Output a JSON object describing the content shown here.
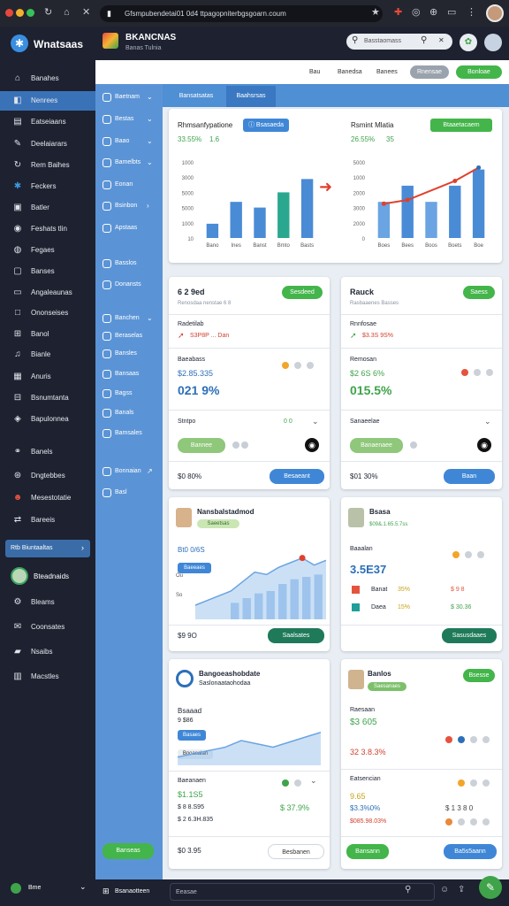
{
  "browser": {
    "url": "Gfsmpubendetai01 0d4 ttpagopniterbgsgoarn.coum",
    "traffic_colors": [
      "#e8473c",
      "#f2b22b",
      "#37c15a"
    ]
  },
  "sidebar": {
    "logo_text": "Wnatsaas",
    "items": [
      {
        "label": "Banahes",
        "icon": "home-icon"
      },
      {
        "label": "Nenrees",
        "icon": "layers-icon"
      },
      {
        "label": "Eatseiaans",
        "icon": "document-icon"
      },
      {
        "label": "Deelaiarars",
        "icon": "pen-icon"
      },
      {
        "label": "Rem Baihes",
        "icon": "refresh-icon"
      },
      {
        "label": "Feckers",
        "icon": "star-icon"
      },
      {
        "label": "Batler",
        "icon": "box-icon"
      },
      {
        "label": "Feshats tlin",
        "icon": "camera-icon"
      },
      {
        "label": "Fegaes",
        "icon": "globe-icon"
      },
      {
        "label": "Banses",
        "icon": "chat-icon"
      },
      {
        "label": "Angaleaunas",
        "icon": "screen-icon"
      },
      {
        "label": "Ononseises",
        "icon": "square-icon"
      },
      {
        "label": "Banol",
        "icon": "grid-icon"
      },
      {
        "label": "Bianle",
        "icon": "music-icon"
      },
      {
        "label": "Anuris",
        "icon": "calendar-icon"
      },
      {
        "label": "Bsnumtanta",
        "icon": "tiles-icon"
      },
      {
        "label": "Bapulonnea",
        "icon": "cube-icon"
      },
      {
        "label": "Banels",
        "icon": "link-icon"
      },
      {
        "label": "Dngtebbes",
        "icon": "compass-icon"
      },
      {
        "label": "Mesestotatie",
        "icon": "user-icon"
      },
      {
        "label": "Bareeis",
        "icon": "shuffle-icon"
      }
    ],
    "search_label": "Rtb Biuntaaltas",
    "profile_label": "Bteadnaids",
    "lower_items": [
      {
        "label": "Bleams",
        "icon": "gear-icon"
      },
      {
        "label": "Coonsates",
        "icon": "mail-icon"
      },
      {
        "label": "Nsaibs",
        "icon": "folder-icon"
      },
      {
        "label": "Macstles",
        "icon": "archive-icon"
      }
    ],
    "footer_label": "Bme"
  },
  "header": {
    "app_title": "BKANCNAS",
    "app_subtitle": "Banas Tulnia",
    "search_placeholder": "Basstaomass"
  },
  "subheader": {
    "links": [
      "Bau",
      "Banedsa",
      "Banees"
    ],
    "grey_button": "Rnensae",
    "green_button": "Bonloae"
  },
  "panel2": {
    "items": [
      {
        "label": "Baetnam",
        "chevron": "⌄"
      },
      {
        "label": "Bestas",
        "chevron": "⌄"
      },
      {
        "label": "Baao",
        "chevron": "⌄"
      },
      {
        "label": "Bamelbts",
        "chevron": "⌄"
      },
      {
        "label": "Eonan",
        "chevron": ""
      },
      {
        "label": "Bsinbon",
        "chevron": "›"
      },
      {
        "label": "Apstaas",
        "chevron": ""
      },
      {
        "label": "Basslos",
        "chevron": ""
      },
      {
        "label": "Donansts",
        "chevron": ""
      },
      {
        "label": "Banchen",
        "chevron": "⌄"
      },
      {
        "label": "Beraselas",
        "chevron": ""
      },
      {
        "label": "Bansles",
        "chevron": ""
      },
      {
        "label": "Bansaas",
        "chevron": ""
      },
      {
        "label": "Bagss",
        "chevron": ""
      },
      {
        "label": "Banals",
        "chevron": ""
      },
      {
        "label": "Bamsales",
        "chevron": ""
      },
      {
        "label": "Bonnaian",
        "chevron": "↗"
      },
      {
        "label": "Basl",
        "chevron": ""
      }
    ],
    "green_button": "Banseas"
  },
  "tabs": [
    "Bansatsatas",
    "Baahsrsas"
  ],
  "chart_left": {
    "title": "Rhmsanfypatione",
    "badge": "Bsasaeda",
    "value": "33.55%",
    "trend": "1.6"
  },
  "chart_right": {
    "title": "Rsmint Mlatia",
    "badge": "Btaaetacaem",
    "value": "26.55%",
    "trend": "35"
  },
  "chart_data": [
    {
      "type": "bar",
      "categories": [
        "Bano",
        "Ines",
        "Banst",
        "Bmto",
        "Basts"
      ],
      "values": [
        15,
        38,
        32,
        48,
        62
      ],
      "ytick_labels": [
        "10",
        "1000",
        "5000",
        "5000",
        "3000",
        "1000"
      ],
      "colors": [
        "#4a8bd6",
        "#4a8bd6",
        "#4a8bd6",
        "#2aa88f",
        "#4a8bd6"
      ]
    },
    {
      "type": "bar",
      "categories": [
        "Boes",
        "Bees",
        "Boos",
        "Boets",
        "Boe"
      ],
      "values": [
        38,
        55,
        38,
        55,
        72
      ],
      "line_values": [
        36,
        40,
        null,
        60,
        74
      ],
      "ytick_labels": [
        "0",
        "2000",
        "3000",
        "2000",
        "1000",
        "5000"
      ],
      "colors": [
        "#6aa4e2",
        "#4a8bd6",
        "#6aa4e2",
        "#4a8bd6",
        "#4a8bd6"
      ]
    },
    {
      "type": "area",
      "y": [
        12,
        16,
        20,
        24,
        32,
        40,
        38,
        44,
        48,
        52,
        46,
        50
      ],
      "bars": [
        14,
        18,
        22,
        24,
        30,
        34,
        36,
        38
      ],
      "ytick_labels": [
        "Ou",
        "So"
      ]
    },
    {
      "type": "area",
      "y": [
        10,
        14,
        18,
        22,
        30,
        26,
        22,
        28,
        34,
        40
      ],
      "ytick_labels": []
    }
  ],
  "cards": [
    {
      "title": "6 2 9ed",
      "badge": "Sesdeed",
      "sub": "Renosdaa nenstae 6 8",
      "row1_left": "Radetilab",
      "row1_value": "S3P8P ... Dan",
      "row2_label": "Baeabass",
      "row2_value": "$2.85.335",
      "big_value": "021 9%",
      "row3_label": "Stntpo",
      "row3_right": "0 0",
      "pill": "Bannee",
      "footer_value": "$0 80%",
      "footer_button": "Besaeant"
    },
    {
      "title": "Rauck",
      "badge": "Saess",
      "sub": "Rasbaaenes Basses",
      "row1_left": "Rnnfosae",
      "row1_value": "$3.3S 9S%",
      "row2_label": "Remosan",
      "row2_value": "$2 6S 6%",
      "big_value": "015.5%",
      "row3_label": "Sanaeelae",
      "row3_right": "",
      "pill": "Banaenaee",
      "footer_value": "$01 30%",
      "footer_button": "Baan"
    },
    {
      "title": "Nansbalstadmod",
      "badge": "Saeetsas",
      "row1_label": "Bt0 0/6S",
      "row1_pill": "Baeeaes",
      "footer_value": "$9 9O",
      "footer_button": "Saalsates"
    },
    {
      "title": "Bsasa",
      "badge": "$09&.1.65.5.7ss",
      "row1_label": "Baaalan",
      "big_value": "3.5E37",
      "rows": [
        {
          "label": "Banat",
          "pct": "35%",
          "value": "$ 9 8"
        },
        {
          "label": "Daea",
          "pct": "15%",
          "value": "$ 30.36"
        }
      ],
      "footer_button": "Sasusdaaes"
    },
    {
      "title": "Bangoeashobdate",
      "subtitle": "Saslonaataohodaa",
      "row1_label": "Bsaaad",
      "row1_value": "9 $86",
      "pill": "Basaes",
      "pill2": "Bnoasalan",
      "row2_label": "Baeanaen",
      "row2_value": "$1.1S5",
      "row3_value": "$ 8 8.S95",
      "row3_right": "$ 37.9%",
      "row4_value": "$ 2 6.3H.835",
      "footer_value": "$0 3.95",
      "footer_button": "Besbanen"
    },
    {
      "title": "Banlos",
      "badge": "Saesanaes",
      "badge2": "Bsesse",
      "row1_label": "Raesaan",
      "row1_value": "$3 605",
      "row2_value": "32 3.8.3%",
      "row3_label": "Eatsencian",
      "row3_value": "9.65",
      "row4_value": "$3.3%0%",
      "row5_value": "$085.98.03%",
      "row_right": "$ 1 3 8 0",
      "footer_pill": "Bansann",
      "footer_button": "Ba5s5aann"
    }
  ],
  "bottom_bar": {
    "label": "Bsanaotteen",
    "input_placeholder": "Eeasae"
  }
}
